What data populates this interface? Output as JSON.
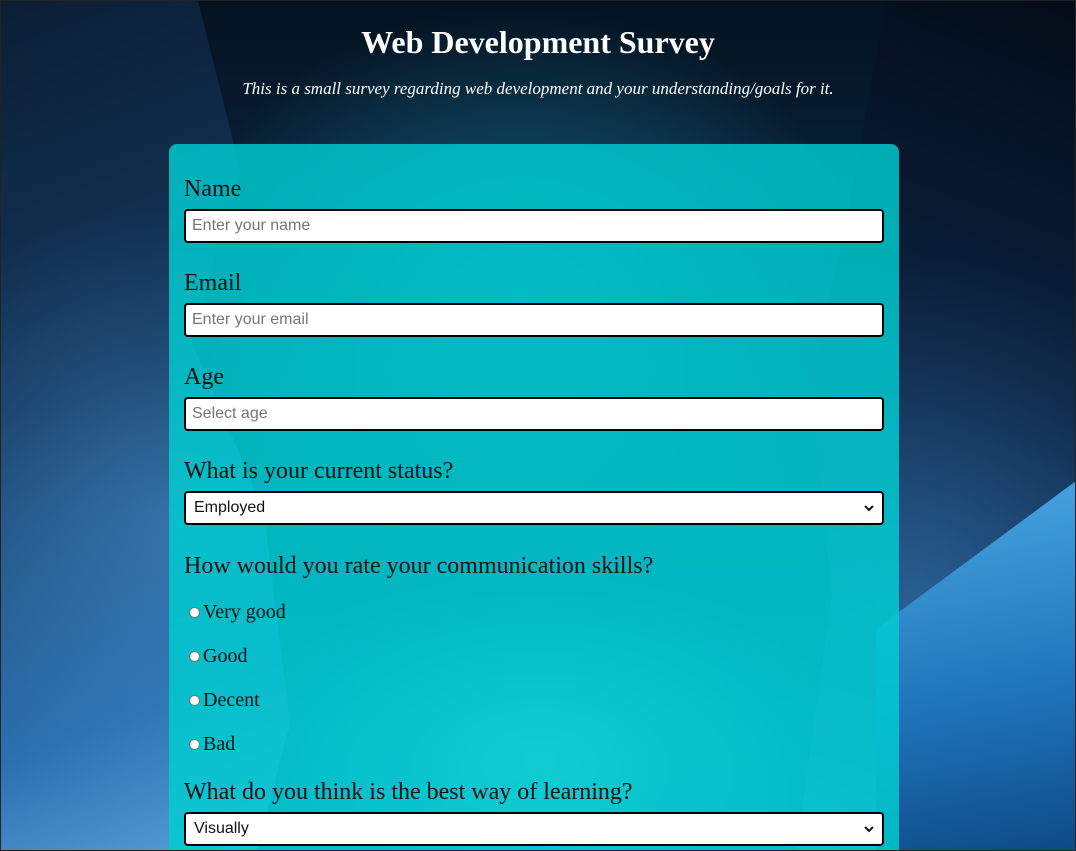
{
  "header": {
    "title": "Web Development Survey",
    "description": "This is a small survey regarding web development and your understanding/goals for it."
  },
  "form": {
    "name": {
      "label": "Name",
      "placeholder": "Enter your name",
      "value": ""
    },
    "email": {
      "label": "Email",
      "placeholder": "Enter your email",
      "value": ""
    },
    "age": {
      "label": "Age",
      "placeholder": "Select age",
      "value": ""
    },
    "status": {
      "label": "What is your current status?",
      "selected": "Employed"
    },
    "communication": {
      "label": "How would you rate your communication skills?",
      "options": [
        "Very good",
        "Good",
        "Decent",
        "Bad"
      ]
    },
    "learning": {
      "label": "What do you think is the best way of learning?",
      "selected": "Visually"
    }
  },
  "colors": {
    "form_background": "#00ced2",
    "title_text": "#ffffff",
    "input_border": "#000000"
  },
  "icons": {
    "select_arrow": "chevron-down-icon"
  }
}
